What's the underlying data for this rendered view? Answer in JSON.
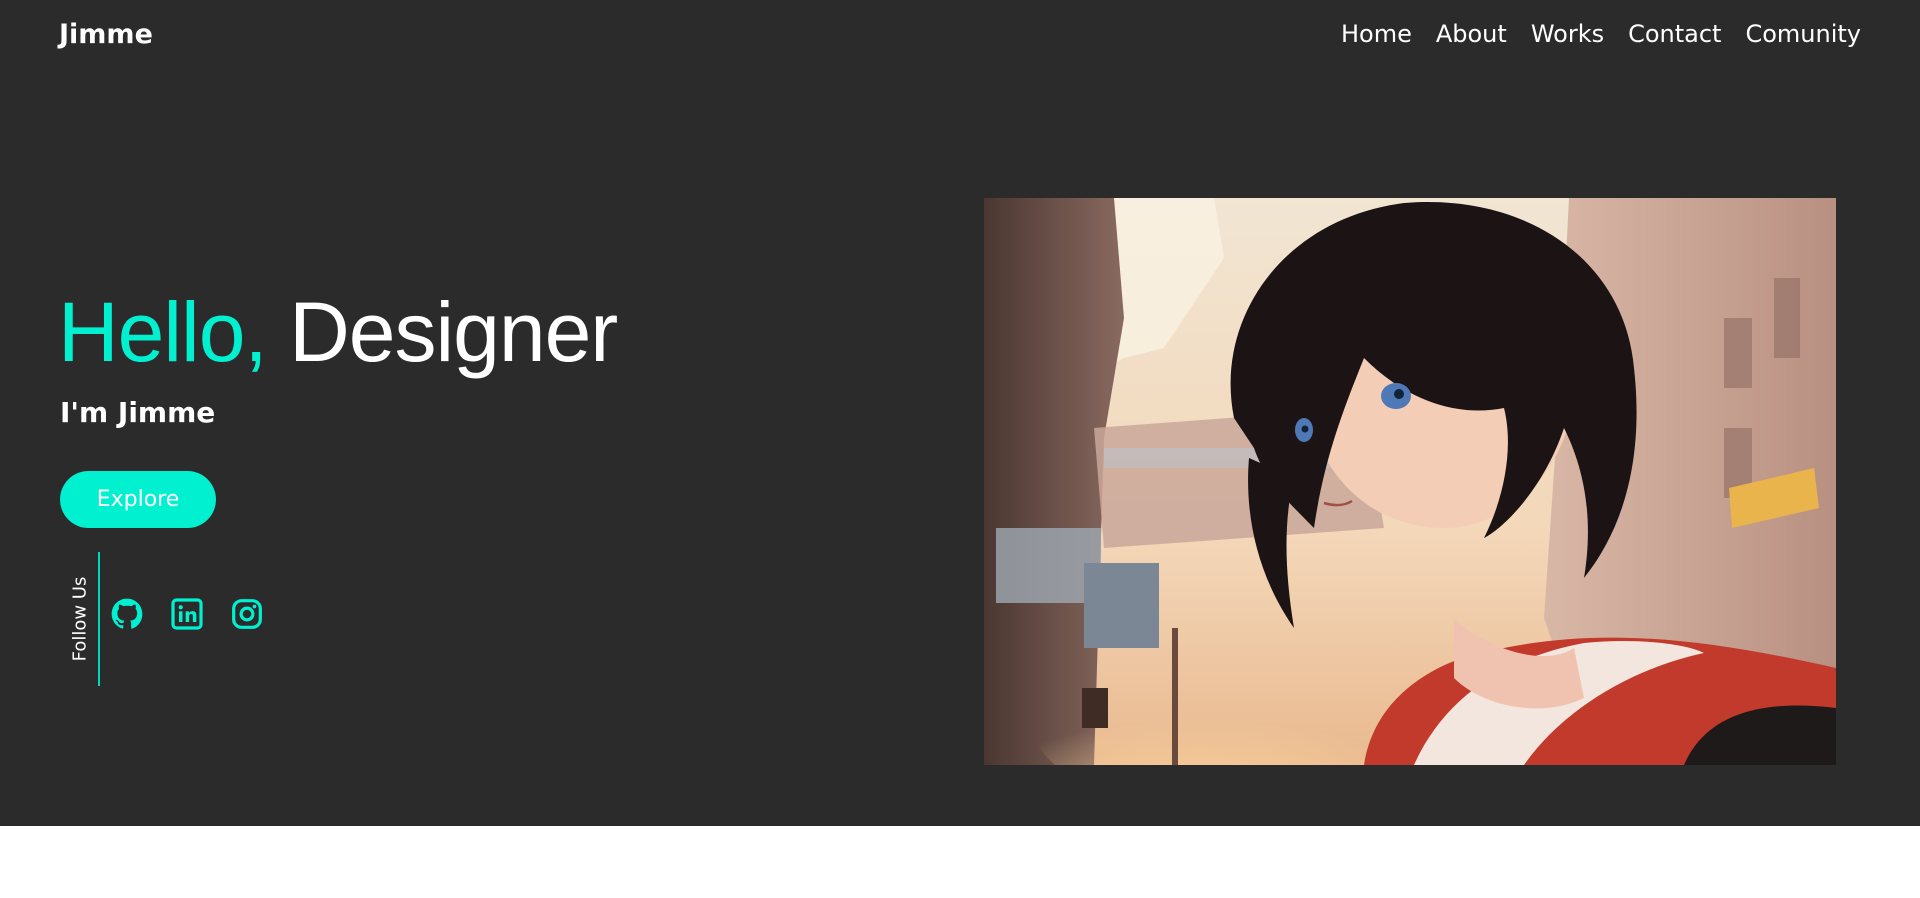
{
  "nav": {
    "brand": "Jimme",
    "links": [
      "Home",
      "About",
      "Works",
      "Contact",
      "Comunity"
    ]
  },
  "hero": {
    "greeting": "Hello,",
    "role": " Designer",
    "subtitle": "I'm Jimme",
    "cta_label": "Explore",
    "follow_label": "Follow Us",
    "socials": [
      "github-icon",
      "linkedin-icon",
      "instagram-icon"
    ],
    "image": "anime-style illustration of a girl with dark bob hair and a red hooded jacket in a sunlit city street"
  },
  "colors": {
    "background": "#2b2b2b",
    "accent": "#00f0d0",
    "text": "#ffffff",
    "page_bottom": "#ffffff"
  }
}
